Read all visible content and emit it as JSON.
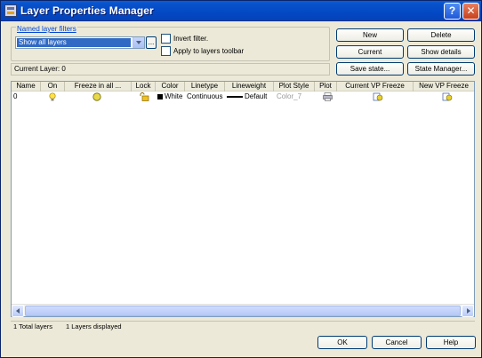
{
  "window": {
    "title": "Layer Properties Manager"
  },
  "titlebar_buttons": {
    "help": "?",
    "close": "✕"
  },
  "filters": {
    "group_label": "Named layer filters",
    "selected": "Show all layers",
    "ellipsis": "...",
    "invert_filter": "Invert filter.",
    "apply_toolbar": "Apply to layers toolbar"
  },
  "buttons": {
    "new": "New",
    "delete": "Delete",
    "current": "Current",
    "show_details": "Show details",
    "save_state": "Save state...",
    "state_manager": "State Manager...",
    "ok": "OK",
    "cancel": "Cancel",
    "help": "Help"
  },
  "current_layer": "Current Layer:  0",
  "columns": [
    "Name",
    "On",
    "Freeze in all ...",
    "Lock",
    "Color",
    "Linetype",
    "Lineweight",
    "Plot Style",
    "Plot",
    "Current VP Freeze",
    "New VP Freeze"
  ],
  "rows": [
    {
      "name": "0",
      "color": "White",
      "linetype": "Continuous",
      "lineweight": "Default",
      "plot_style": "Color_7"
    }
  ],
  "status": {
    "total": "1 Total layers",
    "displayed": "1 Layers displayed"
  },
  "colors": {
    "accent": "#316ac5",
    "titlebar": "#0348c4"
  }
}
